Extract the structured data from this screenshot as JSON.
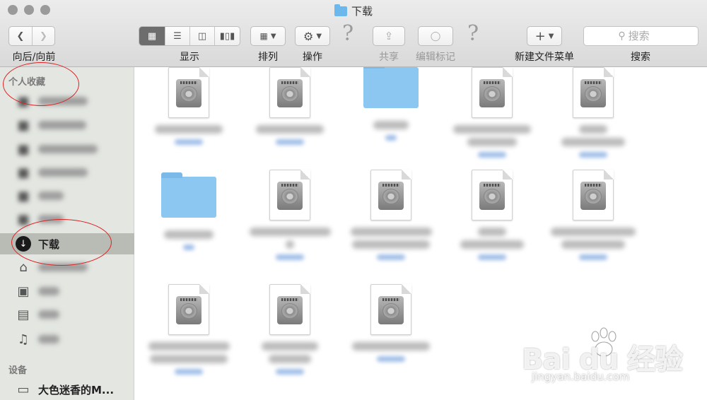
{
  "window": {
    "title": "下载"
  },
  "toolbar": {
    "nav_label": "向后/向前",
    "display_label": "显示",
    "arrange_label": "排列",
    "action_label": "操作",
    "share_label": "共享",
    "edit_tags_label": "编辑标记",
    "new_menu_label": "新建文件菜单",
    "search_label": "搜索",
    "search_placeholder": "搜索",
    "view_modes": [
      "icon-view",
      "list-view",
      "column-view",
      "cover-flow-view"
    ],
    "active_view": "icon-view"
  },
  "sidebar": {
    "favorites_heading": "个人收藏",
    "selected_item": {
      "label": "下载",
      "icon": "download-icon"
    },
    "icon_items": [
      "home-icon",
      "camera-icon",
      "film-icon",
      "music-icon"
    ],
    "devices_heading": "设备",
    "device": {
      "label": "大色迷香的M...",
      "icon": "laptop-icon"
    }
  },
  "files": [
    {
      "kind": "disk-image"
    },
    {
      "kind": "disk-image"
    },
    {
      "kind": "folder"
    },
    {
      "kind": "disk-image"
    },
    {
      "kind": "disk-image"
    },
    {
      "kind": "folder"
    },
    {
      "kind": "disk-image"
    },
    {
      "kind": "disk-image"
    },
    {
      "kind": "disk-image"
    },
    {
      "kind": "disk-image"
    },
    {
      "kind": "disk-image"
    },
    {
      "kind": "disk-image"
    },
    {
      "kind": "disk-image"
    }
  ],
  "watermark": {
    "brand": "Bai du 经验",
    "url": "jingyan.baidu.com"
  },
  "colors": {
    "annotation": "#dd2222",
    "folder": "#8cc7f1",
    "sidebar_bg": "#e3e6e1"
  }
}
